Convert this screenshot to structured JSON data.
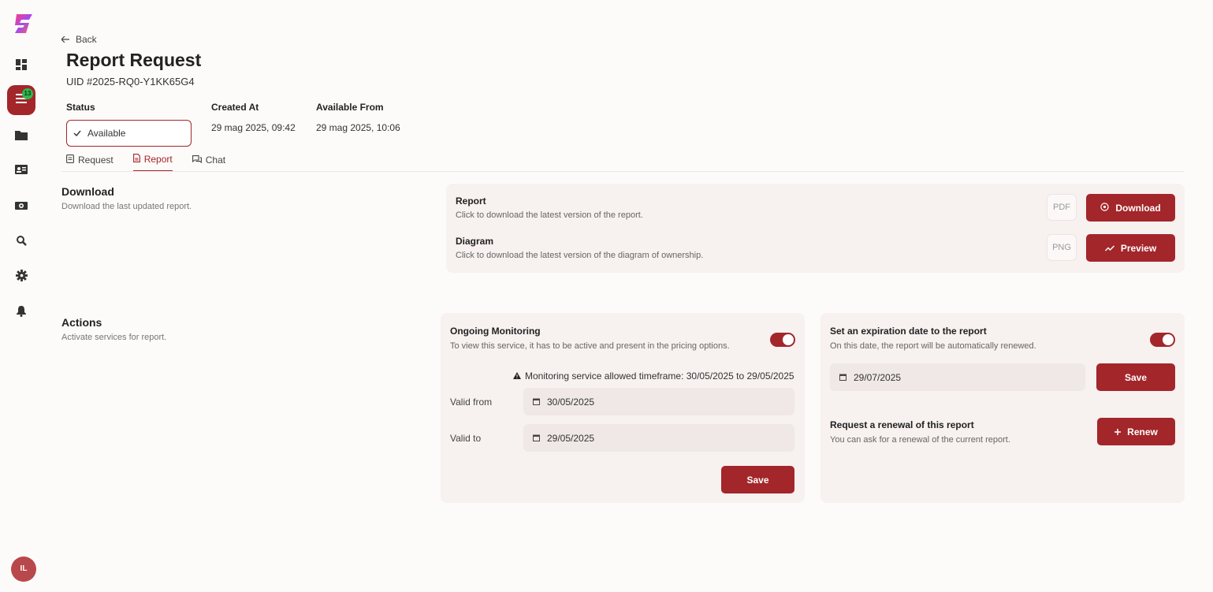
{
  "colors": {
    "accent": "#a3262a",
    "badge": "#2eb84f",
    "card_bg": "#f7f1f0"
  },
  "sidebar": {
    "items": [
      {
        "icon": "dashboard-icon"
      },
      {
        "icon": "list-icon",
        "badge": "13"
      },
      {
        "icon": "folder-icon"
      },
      {
        "icon": "contact-card-icon"
      },
      {
        "icon": "money-icon"
      },
      {
        "icon": "search-icon"
      },
      {
        "icon": "gear-icon"
      },
      {
        "icon": "bell-icon"
      }
    ],
    "avatar": "IL"
  },
  "header": {
    "back_label": "Back",
    "title": "Report Request",
    "uid": "UID #2025-RQ0-Y1KK65G4",
    "status_label": "Status",
    "status_value": "Available",
    "created_label": "Created At",
    "created_value": "29 mag 2025, 09:42",
    "available_label": "Available From",
    "available_value": "29 mag 2025, 10:06"
  },
  "tabs": [
    {
      "label": "Request"
    },
    {
      "label": "Report",
      "active": true
    },
    {
      "label": "Chat"
    }
  ],
  "download": {
    "title": "Download",
    "desc": "Download the last updated report.",
    "report_title": "Report",
    "report_desc": "Click to download the latest version of the report.",
    "report_format": "PDF",
    "report_button": "Download",
    "diagram_title": "Diagram",
    "diagram_desc": "Click to download the latest version of the diagram of ownership.",
    "diagram_format": "PNG",
    "diagram_button": "Preview"
  },
  "actions": {
    "title": "Actions",
    "desc": "Activate services for report.",
    "monitoring": {
      "title": "Ongoing Monitoring",
      "desc": "To view this service, it has to be active and present in the pricing options.",
      "enabled": true,
      "warning": "Monitoring service allowed timeframe: 30/05/2025 to 29/05/2025",
      "valid_from_label": "Valid from",
      "valid_from": "30/05/2025",
      "valid_to_label": "Valid to",
      "valid_to": "29/05/2025",
      "save_label": "Save"
    },
    "expiration": {
      "title": "Set an expiration date to the report",
      "desc": "On this date, the report will be automatically renewed.",
      "enabled": true,
      "date": "29/07/2025",
      "save_label": "Save"
    },
    "renewal": {
      "title": "Request a renewal of this report",
      "desc": "You can ask for a renewal of the current report.",
      "button": "Renew"
    }
  }
}
